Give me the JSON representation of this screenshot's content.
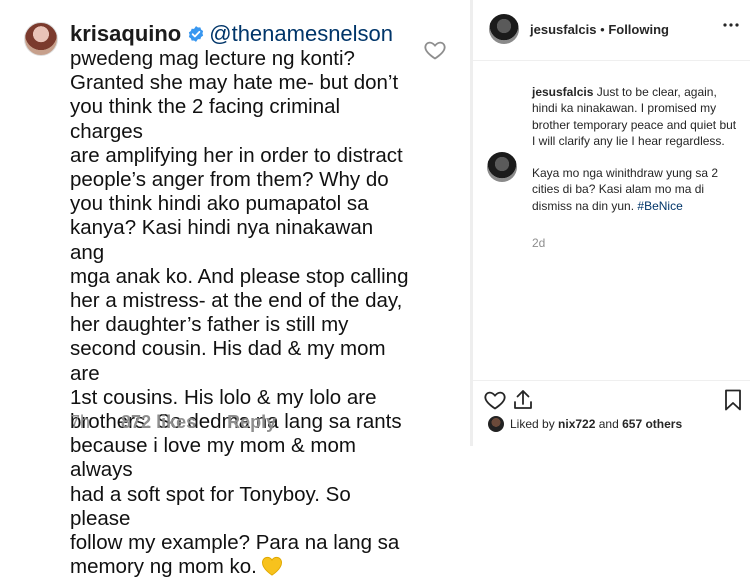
{
  "left_comment": {
    "username": "krisaquino",
    "mention": "@thenamesnelson",
    "lines": [
      "pwedeng mag lecture ng konti?",
      "Granted she may hate me- but don’t",
      "you think the 2 facing criminal charges",
      "are amplifying her in order to distract",
      "people’s anger from them?  Why do",
      "you think hindi ako pumapatol sa",
      "kanya? Kasi hindi nya ninakawan ang",
      "mga anak ko. And please stop calling",
      "her a mistress- at the end of the day,",
      "her daughter’s father is still my",
      "second cousin. His dad & my mom are",
      "1st cousins. His lolo & my lolo are",
      "brothers. So dedma na lang sa rants",
      "because i love my mom & mom always",
      "had a soft spot for Tonyboy. So please",
      "follow my example? Para na lang sa",
      "memory ng mom ko."
    ],
    "time": "7h",
    "likes": "872 likes",
    "reply": "Reply"
  },
  "right_panel": {
    "header_user": "jesusfalcis",
    "header_separator": "•",
    "follow_status": "Following",
    "comment_user": "jesusfalcis",
    "comment_para1": "Just to be clear, again, hindi ka ninakawan. I promised my brother temporary peace and quiet but I will clarify any lie I hear regardless.",
    "comment_para2": "Kaya mo nga winithdraw yung sa 2 cities di ba? Kasi alam mo ma di dismiss na din yun.",
    "comment_hashtag": "#BeNice",
    "time": "2d",
    "liked_by_prefix": "Liked by",
    "liked_by_user": "nix722",
    "liked_by_suffix": "and",
    "liked_by_count": "657 others"
  },
  "icons": [
    "verified-badge-icon",
    "heart-outline-icon",
    "yellow-heart-emoji",
    "comment-icon",
    "share-icon",
    "bookmark-icon",
    "more-dots-icon"
  ],
  "colors": {
    "verified_blue": "#3897f0",
    "mention_blue": "#003569",
    "meta_gray": "#8e8e8e",
    "heart_yellow": "#f7c21d"
  }
}
